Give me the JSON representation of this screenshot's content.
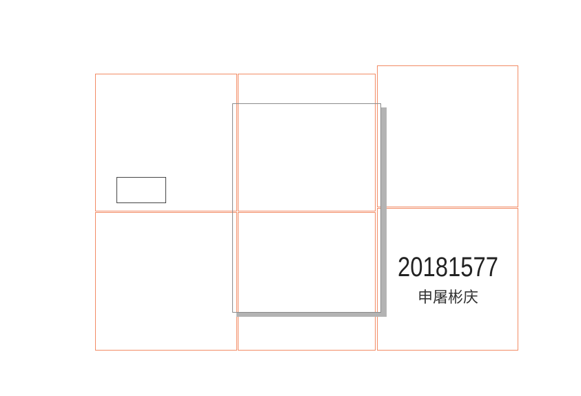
{
  "label": {
    "id": "20181577",
    "name": "申屠彬庆"
  },
  "colors": {
    "cell_border": "#f28a63",
    "overlay_border": "#8a8a8a",
    "shadow": "#b3b3b3",
    "small_rect_border": "#444444",
    "text": "#222222"
  }
}
